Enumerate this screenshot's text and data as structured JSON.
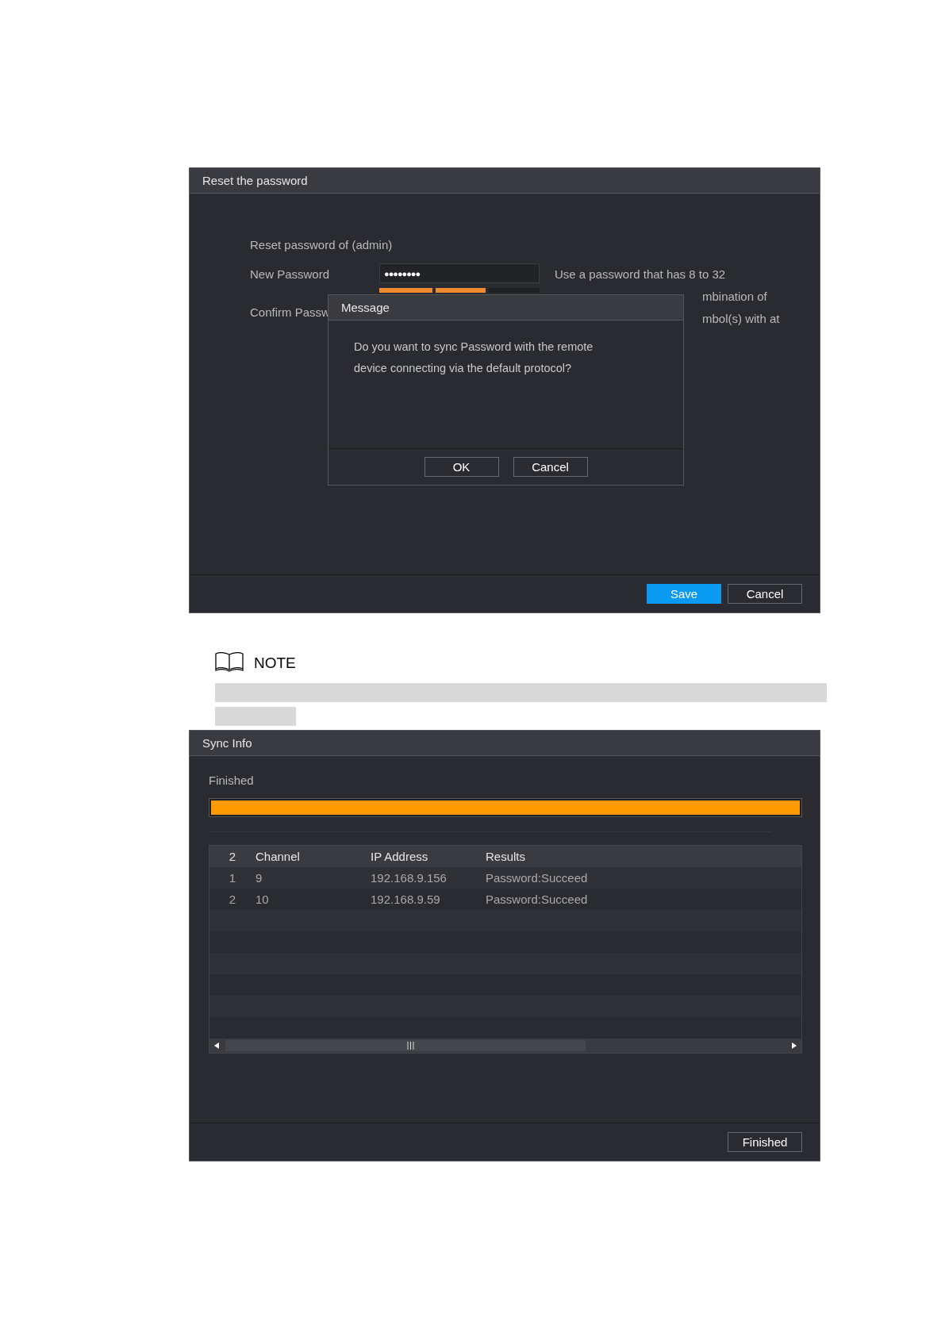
{
  "reset_window": {
    "title": "Reset the password",
    "account_label": "Reset password of (admin)",
    "new_password": {
      "label": "New Password",
      "value": "●●●●●●●●",
      "strength": {
        "level": 0.67
      }
    },
    "confirm_label": "Confirm Passw",
    "hint_lines": [
      "Use a password that has 8 to 32",
      "mbination of",
      "mbol(s) with at"
    ],
    "buttons": [
      {
        "label": "Save",
        "primary": true
      },
      {
        "label": "Cancel",
        "primary": false
      }
    ]
  },
  "message_dialog": {
    "title": "Message",
    "text": "Do you want to sync Password with the remote device connecting via the default protocol?",
    "buttons": [
      "OK",
      "Cancel"
    ]
  },
  "note": {
    "heading": "NOTE"
  },
  "sync_window": {
    "title": "Sync Info",
    "status": "Finished",
    "progress": {
      "level": 1
    },
    "table": {
      "columns": [
        "2",
        "Channel",
        "IP Address",
        "Results"
      ],
      "rows": [
        [
          "1",
          "9",
          "192.168.9.156",
          "Password:Succeed"
        ],
        [
          "2",
          "10",
          "192.168.9.59",
          "Password:Succeed"
        ]
      ]
    },
    "button": "Finished"
  }
}
